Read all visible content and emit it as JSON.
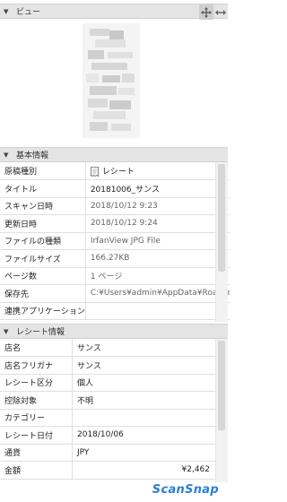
{
  "view_section": {
    "title": "ビュー"
  },
  "basic_section": {
    "title": "基本情報",
    "rows": [
      {
        "label": "原稿種別",
        "value": "レシート",
        "icon": "receipt-icon"
      },
      {
        "label": "タイトル",
        "value": "20181006_サンス"
      },
      {
        "label": "スキャン日時",
        "value": "2018/10/12 9:23",
        "dim": true
      },
      {
        "label": "更新日時",
        "value": "2018/10/12 9:24",
        "dim": true
      },
      {
        "label": "ファイルの種類",
        "value": "IrfanView JPG File",
        "dim": true
      },
      {
        "label": "ファイルサイズ",
        "value": "166.27KB",
        "dim": true
      },
      {
        "label": "ページ数",
        "value": "1 ページ",
        "dim": true
      },
      {
        "label": "保存先",
        "value": "C:¥Users¥admin¥AppData¥Roamin...",
        "dim": true
      },
      {
        "label": "連携アプリケーション",
        "value": ""
      }
    ]
  },
  "receipt_section": {
    "title": "レシート情報",
    "rows": [
      {
        "label": "店名",
        "value": "サンス"
      },
      {
        "label": "店名フリガナ",
        "value": "サンス"
      },
      {
        "label": "レシート区分",
        "value": "個人"
      },
      {
        "label": "控除対象",
        "value": "不明"
      },
      {
        "label": "カテゴリー",
        "value": ""
      },
      {
        "label": "レシート日付",
        "value": "2018/10/06"
      },
      {
        "label": "通貨",
        "value": "JPY"
      },
      {
        "label": "金額",
        "value": "¥2,462",
        "align": "right"
      }
    ]
  },
  "brand": {
    "logo_text": "ScanSnap",
    "color": "#2a7fd4"
  }
}
